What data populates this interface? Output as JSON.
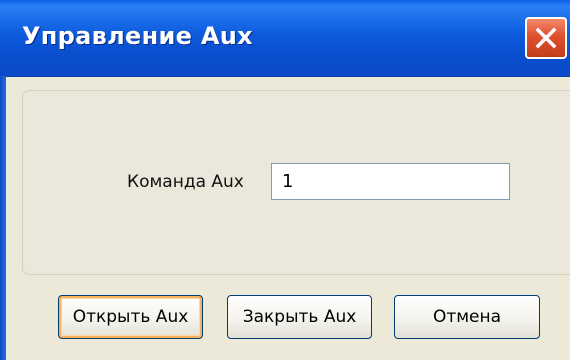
{
  "window": {
    "title": "Управление Aux",
    "close_icon": "close-x-icon"
  },
  "form": {
    "label": "Команда Aux",
    "value": "1"
  },
  "buttons": {
    "open": "Открыть Aux",
    "close": "Закрыть Aux",
    "cancel": "Отмена"
  },
  "colors": {
    "titlebar": "#0c5bdc",
    "close_button": "#e0502d",
    "dialog_background": "#ece9d8",
    "button_focus": "#f8b25b"
  }
}
